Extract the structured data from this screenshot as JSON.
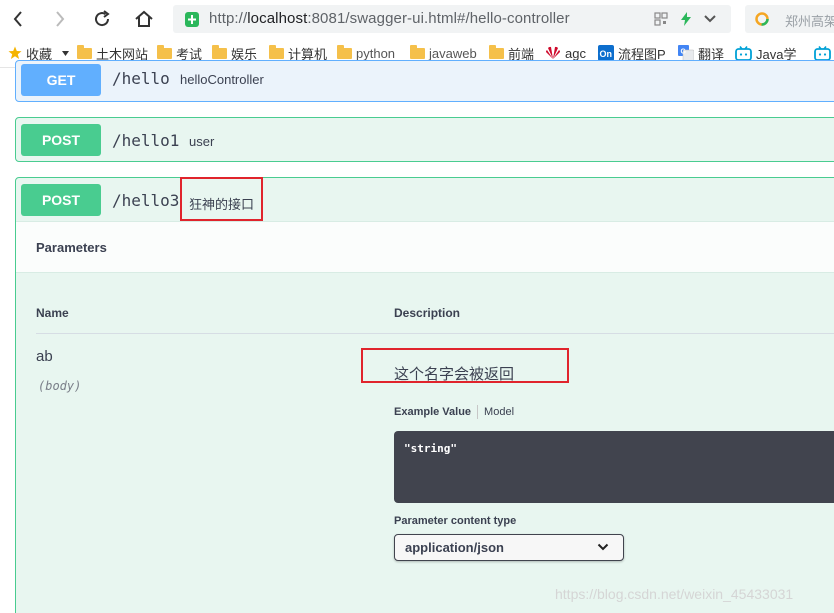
{
  "browser": {
    "url_prefix": "http://",
    "url_host": "localhost",
    "url_rest": ":8081/swagger-ui.html#/hello-controller",
    "search_text": "郑州高架"
  },
  "bookmarks": [
    {
      "label": "收藏",
      "icon": "star-icon"
    },
    {
      "label": "土木网站",
      "icon": "folder-icon"
    },
    {
      "label": "考试",
      "icon": "folder-icon"
    },
    {
      "label": "娱乐",
      "icon": "folder-icon"
    },
    {
      "label": "计算机",
      "icon": "folder-icon"
    },
    {
      "label": "python",
      "icon": "folder-icon"
    },
    {
      "label": "javaweb",
      "icon": "folder-icon"
    },
    {
      "label": "前端",
      "icon": "folder-icon"
    },
    {
      "label": "agc",
      "icon": "huawei-icon"
    },
    {
      "label": "流程图P",
      "icon": "on-icon"
    },
    {
      "label": "翻译",
      "icon": "translate-icon"
    },
    {
      "label": "Java学",
      "icon": "bilibili-icon"
    }
  ],
  "operations": [
    {
      "method": "GET",
      "path": "/hello",
      "summary": "helloController"
    },
    {
      "method": "POST",
      "path": "/hello1",
      "summary": "user"
    },
    {
      "method": "POST",
      "path": "/hello3",
      "summary": "狂神的接口"
    }
  ],
  "parameters": {
    "section_title": "Parameters",
    "col_name": "Name",
    "col_description": "Description",
    "param_name": "ab",
    "param_in": "(body)",
    "param_description": "这个名字会被返回",
    "example_value_tab": "Example Value",
    "model_tab": "Model",
    "example_value": "\"string\"",
    "content_type_label": "Parameter content type",
    "content_type_value": "application/json"
  },
  "watermark": "https://blog.csdn.net/weixin_45433031",
  "colors": {
    "get": "#61affe",
    "post": "#49cc90",
    "highlight": "#e0242c"
  }
}
